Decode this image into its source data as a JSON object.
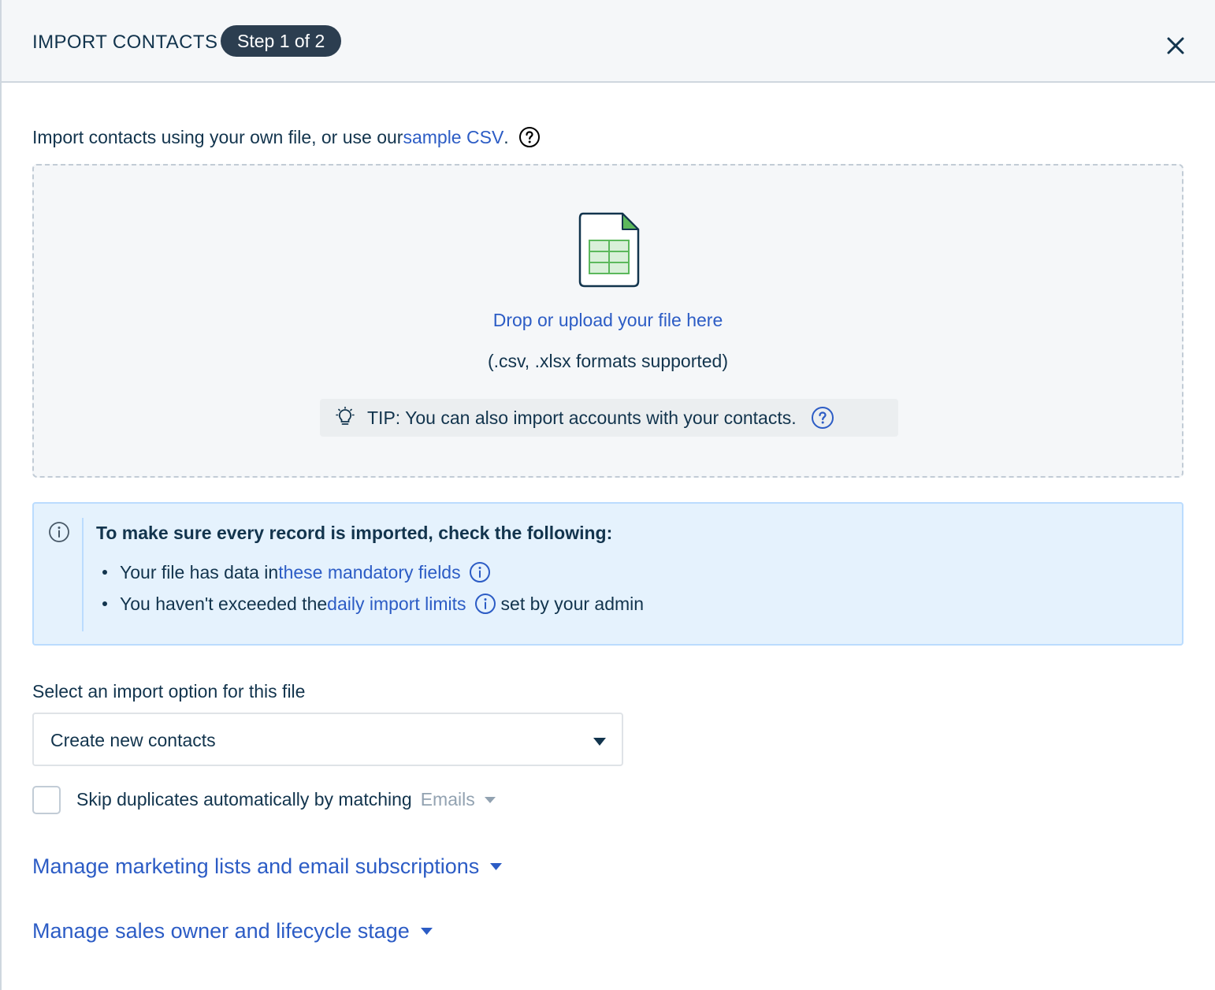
{
  "header": {
    "title": "IMPORT CONTACTS",
    "step_badge": "Step 1 of 2"
  },
  "intro": {
    "text": "Import contacts using your own file, or use our ",
    "link": "sample CSV",
    "suffix": "."
  },
  "dropzone": {
    "upload_link": "Drop or upload your file here",
    "formats": "(.csv, .xlsx formats supported)",
    "tip": "TIP: You can also import accounts with your contacts."
  },
  "info": {
    "title": "To make sure every record is imported, check the following:",
    "item1_prefix": "Your file has data in ",
    "item1_link": "these mandatory fields",
    "item2_prefix": "You haven't exceeded the ",
    "item2_link": "daily import limits",
    "item2_suffix": "set by your admin"
  },
  "import_option": {
    "label": "Select an import option for this file",
    "selected": "Create new contacts"
  },
  "skip_duplicates": {
    "label": "Skip duplicates automatically by matching",
    "match_field": "Emails",
    "checked": false
  },
  "expanders": {
    "marketing": "Manage marketing lists and email subscriptions",
    "sales_owner": "Manage sales owner and lifecycle stage"
  },
  "colors": {
    "link": "#2c5cc5",
    "text": "#12344d",
    "badge_bg": "#2c3e50",
    "info_bg": "#e5f2fd",
    "sheet_green": "#5cb85c"
  }
}
